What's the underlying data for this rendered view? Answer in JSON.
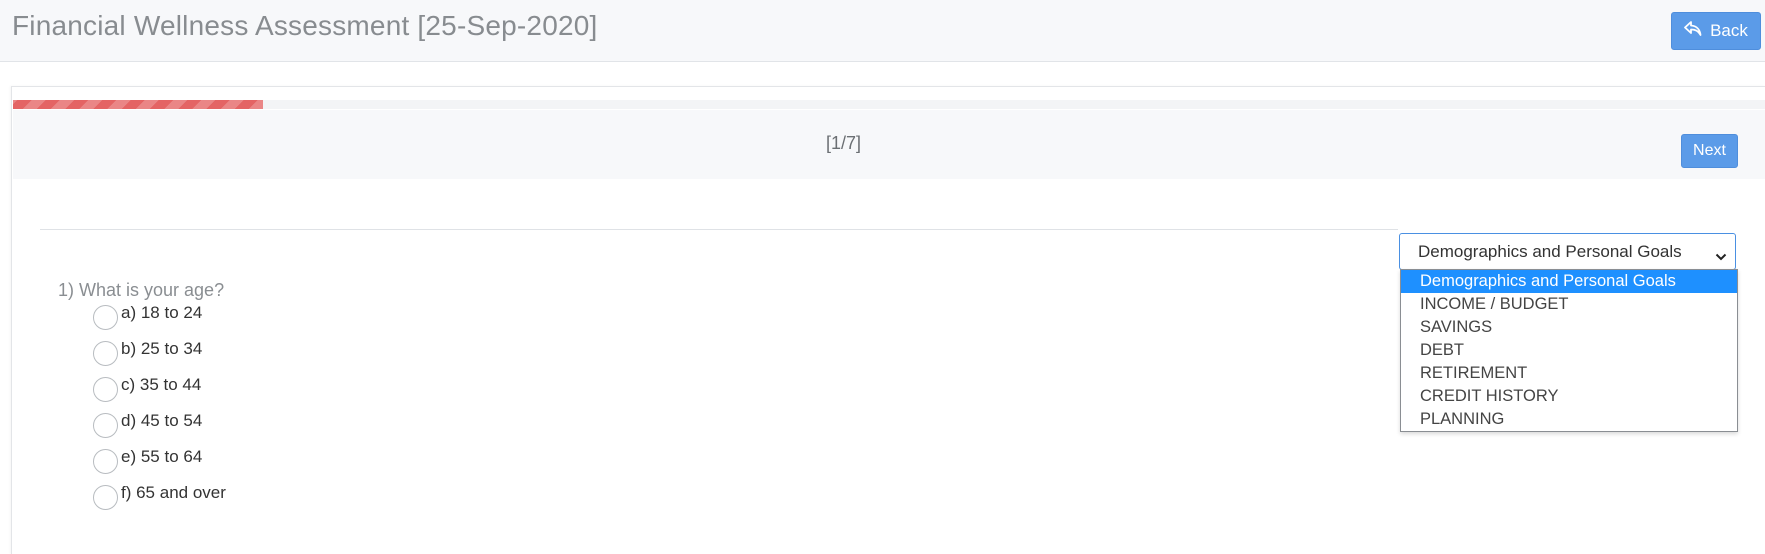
{
  "header": {
    "title": "Financial Wellness Assessment [25-Sep-2020]",
    "back_label": "Back"
  },
  "progress": {
    "fraction": 0.1429,
    "step_label": "[1/7]"
  },
  "nav": {
    "next_label": "Next"
  },
  "section_select": {
    "selected": "Demographics and Personal Goals",
    "options": [
      "Demographics and Personal Goals",
      "INCOME / BUDGET",
      "SAVINGS",
      "DEBT",
      "RETIREMENT",
      "CREDIT HISTORY",
      "PLANNING"
    ]
  },
  "question": {
    "text": "1) What is your age?",
    "options": [
      "a) 18 to 24",
      "b) 25 to 34",
      "c) 35 to 44",
      "d) 45 to 54",
      "e) 55 to 64",
      "f) 65 and over"
    ]
  },
  "colors": {
    "accent": "#5b9be8",
    "progress": "#e46464",
    "dropdown_highlight": "#1e90ff"
  },
  "icons": {
    "back": "reply-arrow-icon",
    "select": "chevron-down-icon"
  }
}
